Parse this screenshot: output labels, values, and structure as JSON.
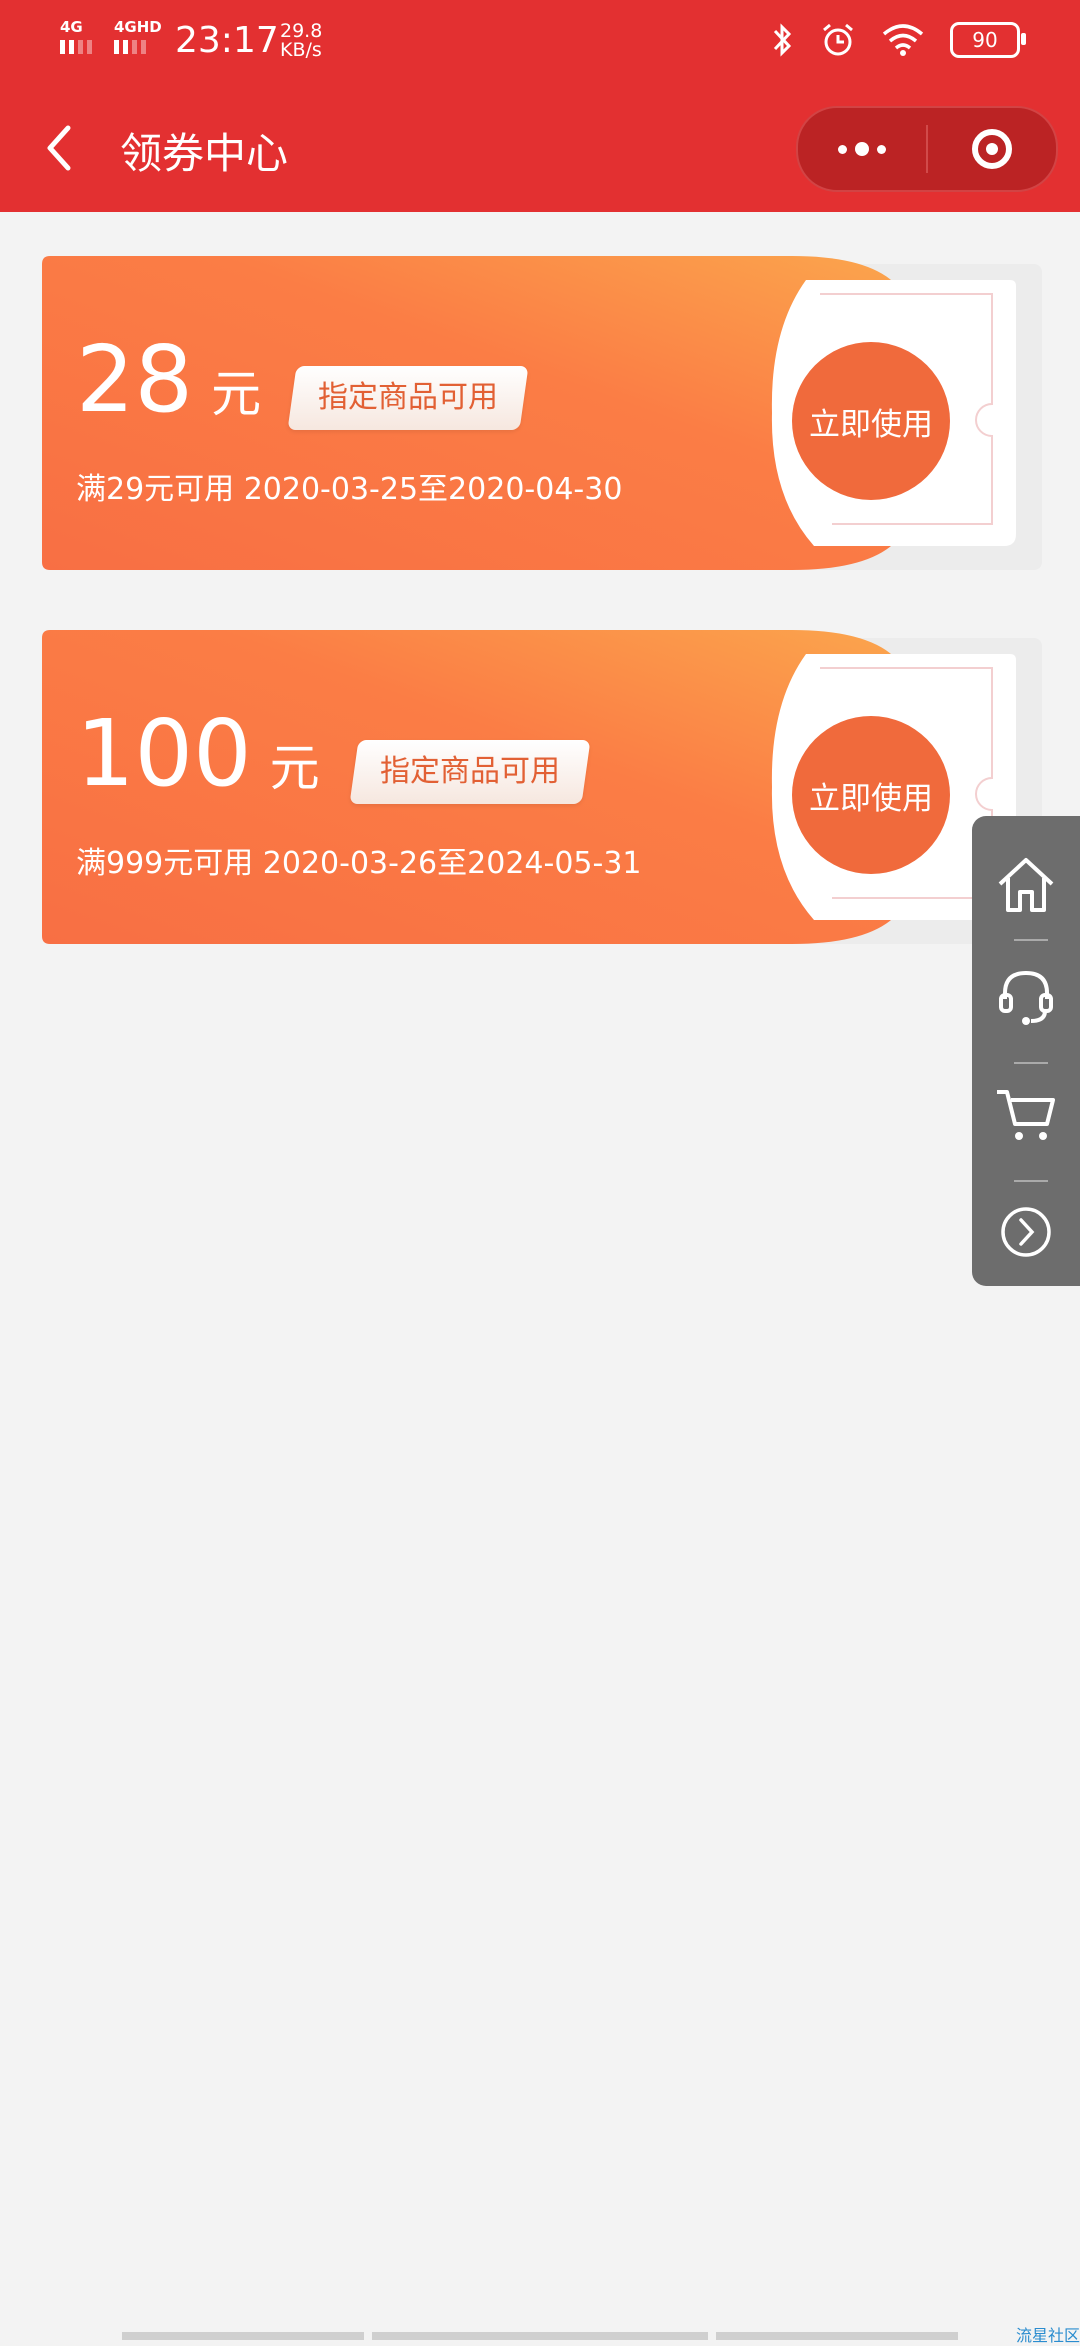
{
  "status_bar": {
    "signal1": "4G",
    "signal2": "4GHD",
    "time": "23:17",
    "speed_value": "29.8",
    "speed_unit": "KB/s",
    "battery": "90",
    "icons": [
      "bluetooth-icon",
      "alarm-icon",
      "wifi-icon",
      "battery-icon"
    ]
  },
  "nav": {
    "title": "领券中心",
    "back_icon": "back-arrow-icon",
    "more_icon": "more-dots-icon",
    "close_icon": "target-icon"
  },
  "coupons": [
    {
      "amount": "28",
      "unit": "元",
      "tag": "指定商品可用",
      "condition": "满29元可用  2020-03-25至2020-04-30",
      "action": "立即使用"
    },
    {
      "amount": "100",
      "unit": "元",
      "tag": "指定商品可用",
      "condition": "满999元可用  2020-03-26至2024-05-31",
      "action": "立即使用"
    }
  ],
  "side_menu": [
    "home-icon",
    "headset-icon",
    "cart-icon",
    "chevron-right-icon"
  ],
  "watermark": "流星社区",
  "colors": {
    "header": "#e33031",
    "coupon_start": "#f86f44",
    "coupon_end": "#fba64d",
    "button": "#f06a3c"
  }
}
